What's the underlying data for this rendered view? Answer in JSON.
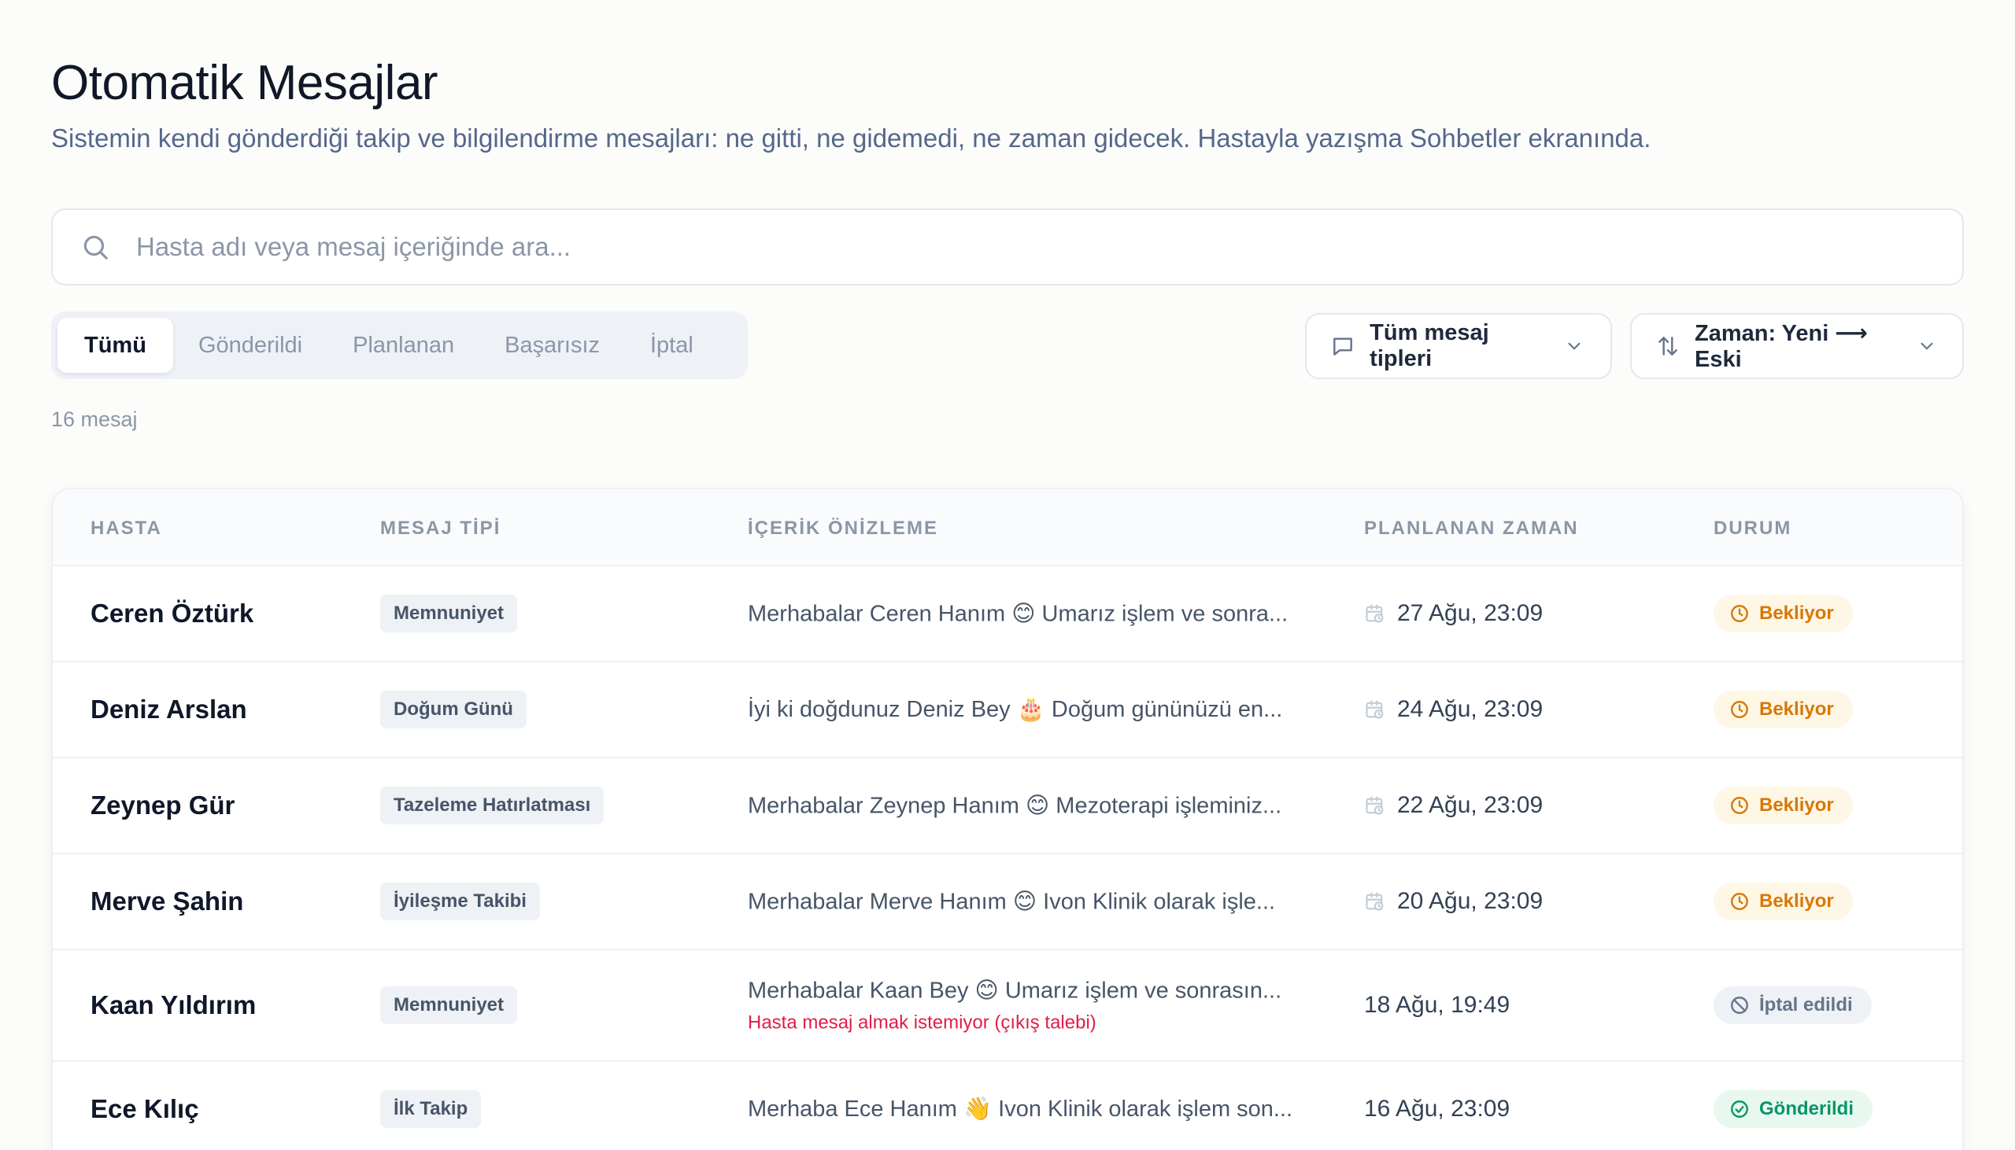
{
  "header": {
    "title": "Otomatik Mesajlar",
    "subtitle": "Sistemin kendi gönderdiği takip ve bilgilendirme mesajları: ne gitti, ne gidemedi, ne zaman gidecek. Hastayla yazışma Sohbetler ekranında."
  },
  "search": {
    "placeholder": "Hasta adı veya mesaj içeriğinde ara...",
    "value": ""
  },
  "tabs": [
    {
      "label": "Tümü",
      "active": true
    },
    {
      "label": "Gönderildi",
      "active": false
    },
    {
      "label": "Planlanan",
      "active": false
    },
    {
      "label": "Başarısız",
      "active": false
    },
    {
      "label": "İptal",
      "active": false
    }
  ],
  "filters": {
    "type_label": "Tüm mesaj tipleri",
    "sort_label": "Zaman: Yeni ⟶ Eski"
  },
  "count_label": "16 mesaj",
  "table": {
    "headers": [
      "HASTA",
      "MESAJ TİPİ",
      "İÇERİK ÖNİZLEME",
      "PLANLANAN ZAMAN",
      "DURUM"
    ],
    "rows": [
      {
        "patient": "Ceren Öztürk",
        "type": "Memnuniyet",
        "preview": "Merhabalar Ceren Hanım 😊  Umarız işlem ve sonra...",
        "note": "",
        "time": "27 Ağu, 23:09",
        "scheduled": true,
        "status": "Bekliyor",
        "status_kind": "pending"
      },
      {
        "patient": "Deniz Arslan",
        "type": "Doğum Günü",
        "preview": "İyi ki doğdunuz Deniz Bey 🎂  Doğum gününüzü en...",
        "note": "",
        "time": "24 Ağu, 23:09",
        "scheduled": true,
        "status": "Bekliyor",
        "status_kind": "pending"
      },
      {
        "patient": "Zeynep Gür",
        "type": "Tazeleme Hatırlatması",
        "preview": "Merhabalar Zeynep Hanım 😊  Mezoterapi işleminiz...",
        "note": "",
        "time": "22 Ağu, 23:09",
        "scheduled": true,
        "status": "Bekliyor",
        "status_kind": "pending"
      },
      {
        "patient": "Merve Şahin",
        "type": "İyileşme Takibi",
        "preview": "Merhabalar Merve Hanım 😊  Ivon Klinik olarak işle...",
        "note": "",
        "time": "20 Ağu, 23:09",
        "scheduled": true,
        "status": "Bekliyor",
        "status_kind": "pending"
      },
      {
        "patient": "Kaan Yıldırım",
        "type": "Memnuniyet",
        "preview": "Merhabalar Kaan Bey 😊  Umarız işlem ve sonrasın...",
        "note": "Hasta mesaj almak istemiyor (çıkış talebi)",
        "time": "18 Ağu, 19:49",
        "scheduled": false,
        "status": "İptal edildi",
        "status_kind": "cancel"
      },
      {
        "patient": "Ece Kılıç",
        "type": "İlk Takip",
        "preview": "Merhaba Ece Hanım 👋  Ivon Klinik olarak işlem son...",
        "note": "",
        "time": "16 Ağu, 23:09",
        "scheduled": false,
        "status": "Gönderildi",
        "status_kind": "sent"
      }
    ]
  },
  "colors": {
    "pending": "#d97706",
    "cancel": "#64748b",
    "sent": "#059669",
    "note": "#e11d48"
  },
  "icons": {
    "search": "search-icon",
    "type_filter": "message-square-icon",
    "sort": "sort-arrows-icon",
    "chevron": "chevron-down-icon",
    "calendar": "calendar-clock-icon",
    "pending": "clock-icon",
    "cancel": "ban-icon",
    "sent": "check-circle-icon"
  }
}
